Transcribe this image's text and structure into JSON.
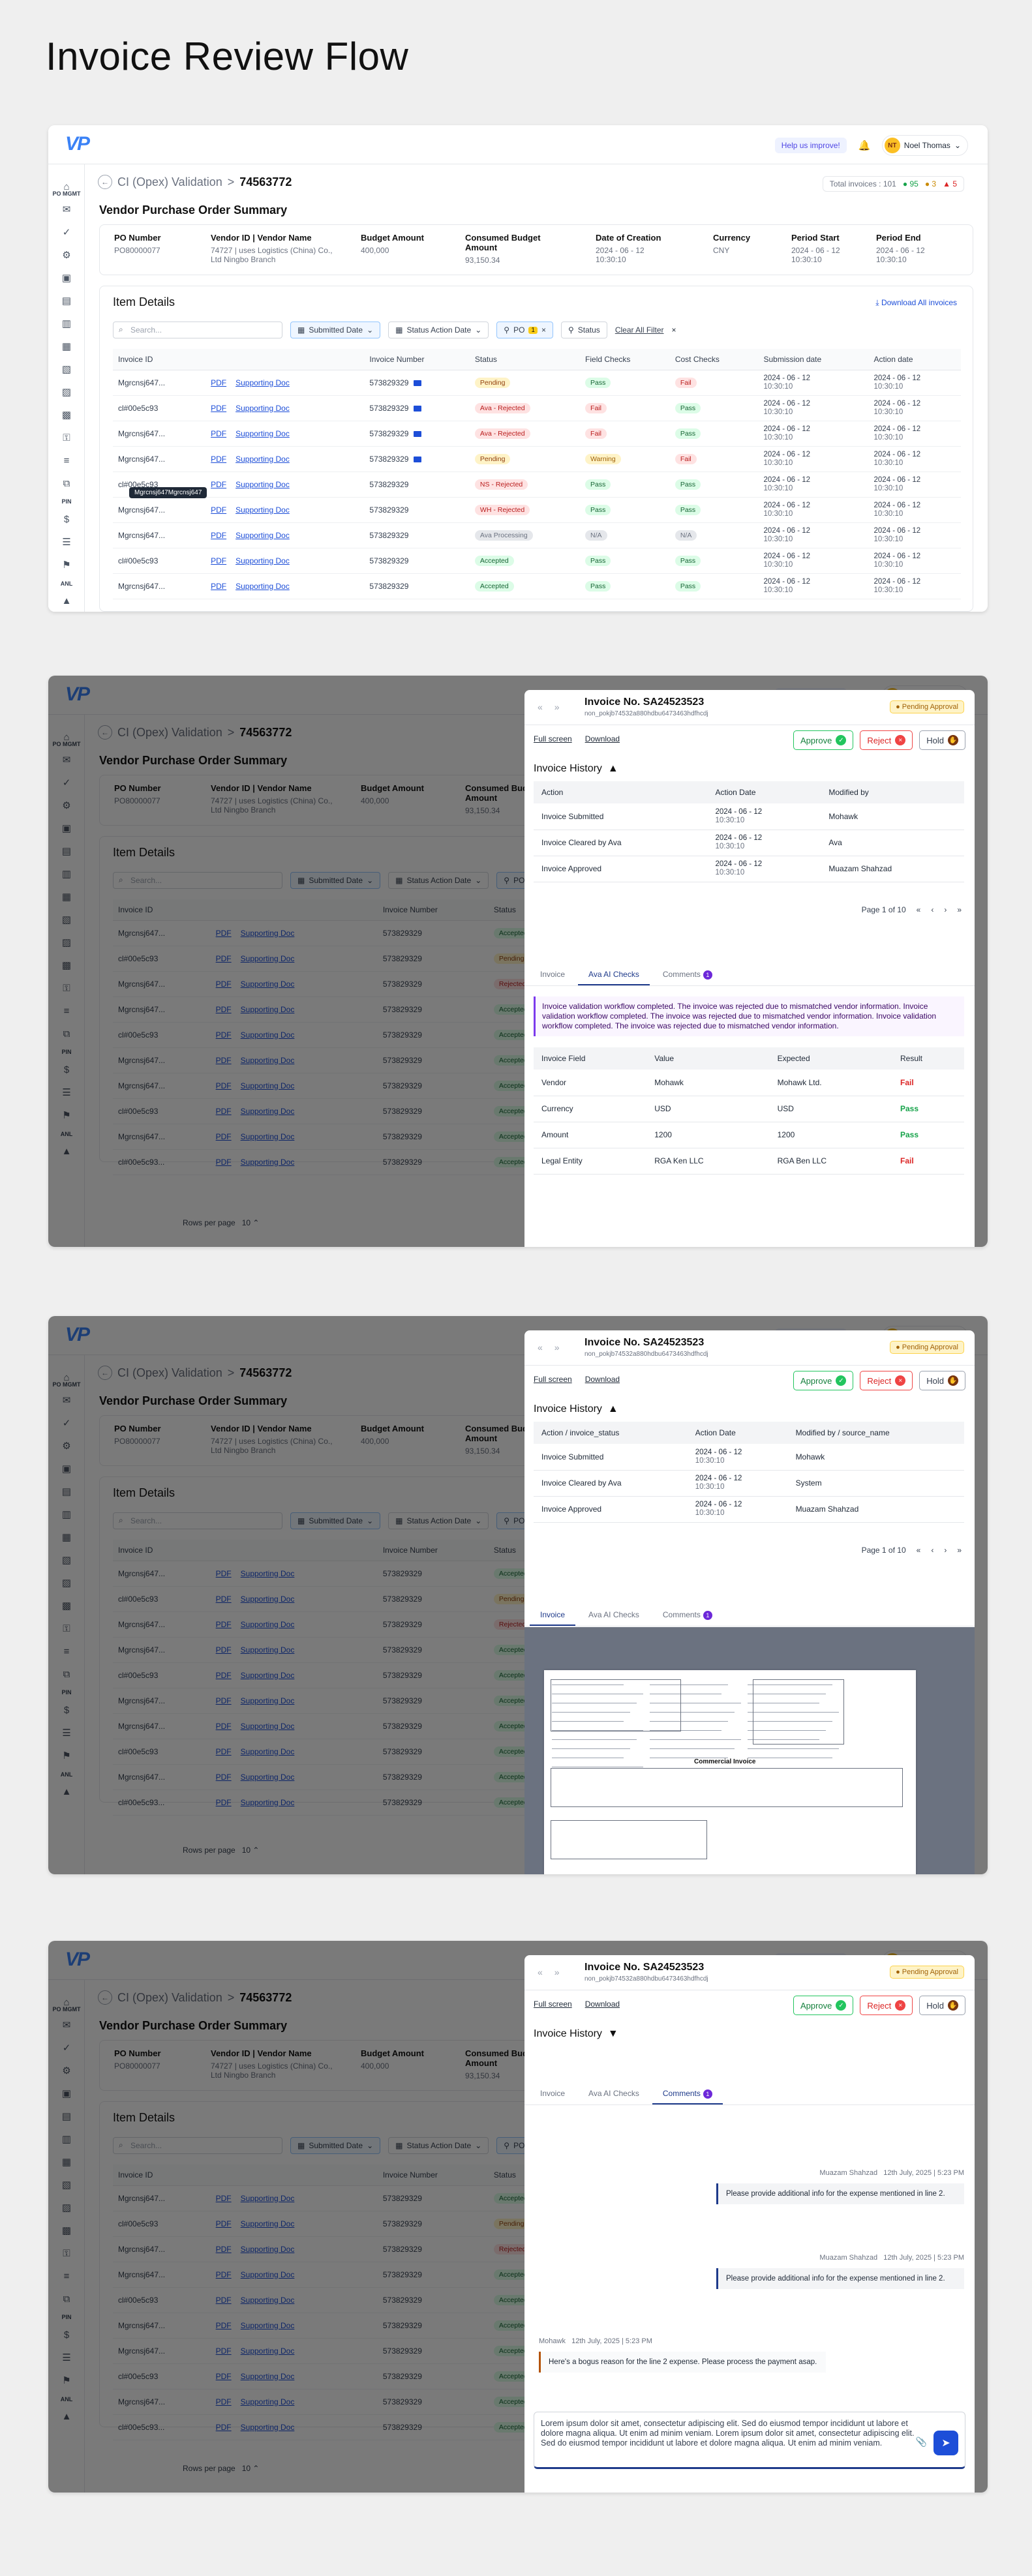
{
  "page_title": "Invoice Review Flow",
  "app": {
    "logo": "VP",
    "help": "Help us improve!",
    "user": {
      "initials": "NT",
      "name": "Noel Thomas"
    },
    "sidebar_labels": [
      "PO MGMT",
      "PIN",
      "ANL"
    ]
  },
  "breadcrumb": {
    "parent": "CI (Opex) Validation",
    "sep": ">",
    "current": "74563772"
  },
  "stats": {
    "total": "Total invoices : 101",
    "green": "95",
    "yellow": "3",
    "red": "5"
  },
  "summary": {
    "title": "Vendor Purchase Order Summary",
    "cols": [
      {
        "label": "PO Number",
        "value": "PO80000077"
      },
      {
        "label": "Vendor ID | Vendor Name",
        "value": "74727 | uses Logistics (China) Co., Ltd Ningbo Branch"
      },
      {
        "label": "Budget Amount",
        "value": "400,000"
      },
      {
        "label": "Consumed Budget Amount",
        "value": "93,150.34"
      },
      {
        "label": "Date of Creation",
        "value": "2024 - 06 - 12\n10:30:10"
      },
      {
        "label": "Currency",
        "value": "CNY"
      },
      {
        "label": "Period Start",
        "value": "2024 - 06 - 12\n10:30:10"
      },
      {
        "label": "Period End",
        "value": "2024 - 06 - 12\n10:30:10"
      }
    ]
  },
  "items": {
    "title": "Item Details",
    "download_all": "Download All invoices",
    "search_placeholder": "Search...",
    "filters": [
      "Submitted Date",
      "Status Action Date",
      "PO",
      "Status"
    ],
    "po_count": "1",
    "clear": "Clear All Filter",
    "headers": [
      "Invoice ID",
      "",
      "Invoice Number",
      "Status",
      "Field Checks",
      "Cost Checks",
      "Submission date",
      "Action date"
    ],
    "pdf": "PDF",
    "supporting": "Supporting Doc",
    "rows": [
      {
        "id": "Mgrcnsj647...",
        "num": "573829329",
        "status": "Pending",
        "sc": "c-pend",
        "field": "Pass",
        "fc": "c-acc",
        "cost": "Fail",
        "cc": "c-rej",
        "mail": true
      },
      {
        "id": "cl#00e5c93",
        "num": "573829329",
        "status": "Ava - Rejected",
        "sc": "c-rej",
        "field": "Fail",
        "fc": "c-rej",
        "cost": "Pass",
        "cc": "c-acc",
        "mail": true
      },
      {
        "id": "Mgrcnsj647...",
        "num": "573829329",
        "status": "Ava - Rejected",
        "sc": "c-rej",
        "field": "Fail",
        "fc": "c-rej",
        "cost": "Pass",
        "cc": "c-acc",
        "mail": true
      },
      {
        "id": "Mgrcnsj647...",
        "num": "573829329",
        "status": "Pending",
        "sc": "c-pend",
        "field": "Warning",
        "fc": "c-warn",
        "cost": "Fail",
        "cc": "c-rej",
        "mail": true
      },
      {
        "id": "cl#00e5c93",
        "num": "573829329",
        "status": "NS - Rejected",
        "sc": "c-rej",
        "field": "Pass",
        "fc": "c-acc",
        "cost": "Pass",
        "cc": "c-acc",
        "mail": false
      },
      {
        "id": "Mgrcnsj647...",
        "num": "573829329",
        "status": "WH - Rejected",
        "sc": "c-rej",
        "field": "Pass",
        "fc": "c-acc",
        "cost": "Pass",
        "cc": "c-acc",
        "mail": false
      },
      {
        "id": "Mgrcnsj647...",
        "num": "573829329",
        "status": "Ava Processing",
        "sc": "c-grey",
        "field": "N/A",
        "fc": "c-grey",
        "cost": "N/A",
        "cc": "c-grey",
        "mail": false
      },
      {
        "id": "cl#00e5c93",
        "num": "573829329",
        "status": "Accepted",
        "sc": "c-acc",
        "field": "Pass",
        "fc": "c-acc",
        "cost": "Pass",
        "cc": "c-acc",
        "mail": false
      },
      {
        "id": "Mgrcnsj647...",
        "num": "573829329",
        "status": "Accepted",
        "sc": "c-acc",
        "field": "Pass",
        "fc": "c-acc",
        "cost": "Pass",
        "cc": "c-acc",
        "mail": false
      }
    ],
    "date": "2024 - 06 - 12",
    "time": "10:30:10",
    "tooltip": "Mgrcnsj647Mgrcnsj647",
    "bg_rows": [
      {
        "id": "Mgrcnsj647...",
        "status": "Accepted",
        "sc": "c-acc"
      },
      {
        "id": "cl#00e5c93",
        "status": "Pending",
        "sc": "c-pend"
      },
      {
        "id": "Mgrcnsj647...",
        "status": "Rejected",
        "sc": "c-rej"
      },
      {
        "id": "Mgrcnsj647...",
        "status": "Accepted",
        "sc": "c-acc"
      },
      {
        "id": "cl#00e5c93",
        "status": "Accepted",
        "sc": "c-acc"
      },
      {
        "id": "Mgrcnsj647...",
        "status": "Accepted",
        "sc": "c-acc"
      },
      {
        "id": "Mgrcnsj647...",
        "status": "Accepted",
        "sc": "c-acc"
      },
      {
        "id": "cl#00e5c93",
        "status": "Accepted",
        "sc": "c-acc"
      },
      {
        "id": "Mgrcnsj647...",
        "status": "Accepted",
        "sc": "c-acc"
      },
      {
        "id": "cl#00e5c93...",
        "status": "Accepted",
        "sc": "c-acc"
      }
    ],
    "rows_per_page": "Rows per page",
    "rpp_value": "10"
  },
  "drawer": {
    "title": "Invoice No. SA24523523",
    "subtitle": "non_pokjb74532a880hdbu6473463hdfhcdj",
    "pending": "Pending Approval",
    "full_screen": "Full screen",
    "download": "Download",
    "approve": "Approve",
    "reject": "Reject",
    "hold": "Hold",
    "history_title": "Invoice History",
    "hist_headers_a": [
      "Action",
      "Action Date",
      "Modified by"
    ],
    "hist_headers_b": [
      "Action / invoice_status",
      "Action Date",
      "Modified by / source_name"
    ],
    "hist_rows_a": [
      {
        "action": "Invoice Submitted",
        "by": "Mohawk"
      },
      {
        "action": "Invoice Cleared by Ava",
        "by": "Ava"
      },
      {
        "action": "Invoice Approved",
        "by": "Muazam Shahzad"
      }
    ],
    "hist_rows_b": [
      {
        "action": "Invoice Submitted",
        "by": "Mohawk"
      },
      {
        "action": "Invoice Cleared by Ava",
        "by": "System"
      },
      {
        "action": "Invoice Approved",
        "by": "Muazam Shahzad"
      }
    ],
    "page_of": "Page 1 of 10",
    "tabs": [
      "Invoice",
      "Ava AI Checks",
      "Comments"
    ],
    "comments_count": "1",
    "notice": "Invoice validation workflow completed. The invoice was rejected due to mismatched vendor information. Invoice validation workflow completed. The invoice was rejected due to mismatched vendor information. Invoice validation workflow completed. The invoice was rejected due to mismatched vendor information.",
    "check_headers": [
      "Invoice Field",
      "Value",
      "Expected",
      "Result"
    ],
    "checks": [
      {
        "field": "Vendor",
        "value": "Mohawk",
        "expected": "Mohawk Ltd.",
        "result": "Fail"
      },
      {
        "field": "Currency",
        "value": "USD",
        "expected": "USD",
        "result": "Pass"
      },
      {
        "field": "Amount",
        "value": "1200",
        "expected": "1200",
        "result": "Pass"
      },
      {
        "field": "Legal Entity",
        "value": "RGA Ken LLC",
        "expected": "RGA Ben LLC",
        "result": "Fail"
      }
    ],
    "doc_heading": "Commercial Invoice",
    "comments": [
      {
        "who": "Muazam Shahzad",
        "when": "12th July, 2025 | 5:23 PM",
        "text": "Please provide additional info for the expense mentioned in line 2."
      },
      {
        "who": "Muazam Shahzad",
        "when": "12th July, 2025 | 5:23 PM",
        "text": "Please provide additional info for the expense mentioned in line 2."
      },
      {
        "who": "Mohawk",
        "when": "12th July, 2025 | 5:23 PM",
        "text": "Here's a bogus reason for the line 2 expense. Please process the payment asap."
      }
    ],
    "composer": "Lorem ipsum dolor sit amet, consectetur adipiscing elit. Sed do eiusmod tempor incididunt ut labore et dolore magna aliqua. Ut enim ad minim veniam. Lorem ipsum dolor sit amet, consectetur adipiscing elit. Sed do eiusmod tempor incididunt ut labore et dolore magna aliqua. Ut enim ad minim veniam."
  }
}
